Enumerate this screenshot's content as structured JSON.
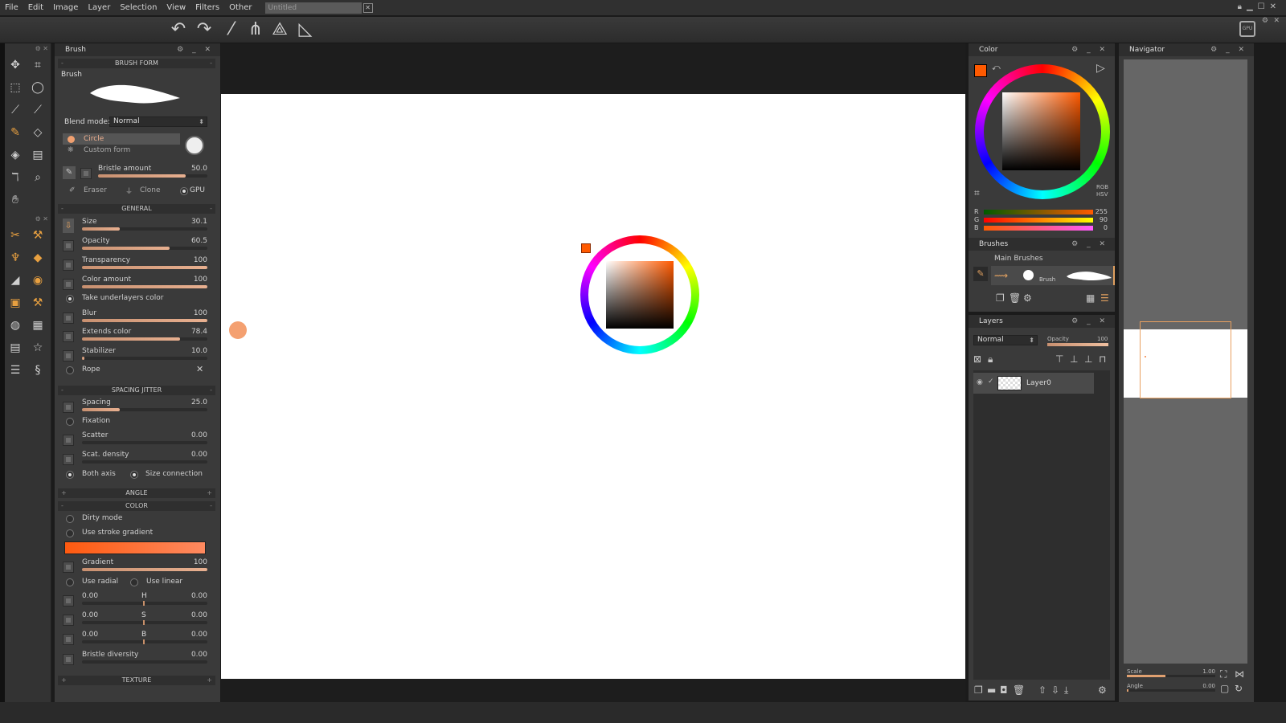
{
  "menu": {
    "items": [
      "File",
      "Edit",
      "Image",
      "Layer",
      "Selection",
      "View",
      "Filters",
      "Other"
    ],
    "doc_tab": "Untitled"
  },
  "brush_panel": {
    "title": "Brush",
    "brush_form_header": "BRUSH FORM",
    "brush_label": "Brush",
    "blend_mode_label": "Blend mode:",
    "blend_mode_value": "Normal",
    "shape_circle": "Circle",
    "shape_custom": "Custom form",
    "bristle": {
      "label": "Bristle amount",
      "value": "50.0",
      "fraction": 0.8
    },
    "eraser": "Eraser",
    "clone": "Clone",
    "gpu": "GPU",
    "general_header": "GENERAL",
    "general_sliders": [
      {
        "label": "Size",
        "value": "30.1",
        "fraction": 0.3
      },
      {
        "label": "Opacity",
        "value": "60.5",
        "fraction": 0.7
      },
      {
        "label": "Transparency",
        "value": "100",
        "fraction": 1.0
      },
      {
        "label": "Color amount",
        "value": "100",
        "fraction": 1.0
      }
    ],
    "take_underlayers": "Take underlayers color",
    "general_sliders2": [
      {
        "label": "Blur",
        "value": "100",
        "fraction": 1.0
      },
      {
        "label": "Extends color",
        "value": "78.4",
        "fraction": 0.78
      },
      {
        "label": "Stabilizer",
        "value": "10.0",
        "fraction": 0.02
      }
    ],
    "rope": "Rope",
    "spacing_header": "SPACING JITTER",
    "spacing": {
      "label": "Spacing",
      "value": "25.0",
      "fraction": 0.3
    },
    "fixation": "Fixation",
    "scatter": {
      "label": "Scatter",
      "value": "0.00",
      "fraction": 0.0
    },
    "scat_density": {
      "label": "Scat. density",
      "value": "0.00",
      "fraction": 0.0
    },
    "both_axis": "Both axis",
    "size_connection": "Size connection",
    "angle_header": "ANGLE",
    "color_header": "COLOR",
    "dirty_mode": "Dirty mode",
    "use_stroke_gradient": "Use stroke gradient",
    "gradient": {
      "label": "Gradient",
      "value": "100",
      "fraction": 1.0
    },
    "use_radial": "Use radial",
    "use_linear": "Use linear",
    "hsb": [
      {
        "left": "0.00",
        "mid": "H",
        "right": "0.00"
      },
      {
        "left": "0.00",
        "mid": "S",
        "right": "0.00"
      },
      {
        "left": "0.00",
        "mid": "B",
        "right": "0.00"
      }
    ],
    "bristle_diversity": {
      "label": "Bristle diversity",
      "value": "0.00",
      "fraction": 0.0
    },
    "texture_header": "TEXTURE"
  },
  "color_panel": {
    "title": "Color",
    "rgb_label": "RGB",
    "hsv_label": "HSV",
    "r": {
      "label": "R",
      "value": "255"
    },
    "g": {
      "label": "G",
      "value": "90"
    },
    "b": {
      "label": "B",
      "value": "0"
    },
    "current_color": "#ff5a00"
  },
  "brushes_panel": {
    "title": "Brushes",
    "group": "Main Brushes",
    "brush_name": "Brush"
  },
  "layers_panel": {
    "title": "Layers",
    "blend": "Normal",
    "opacity_label": "Opacity",
    "opacity_value": "100",
    "layer_name": "Layer0"
  },
  "navigator": {
    "title": "Navigator",
    "scale_label": "Scale",
    "scale_value": "1.00",
    "angle_label": "Angle",
    "angle_value": "0.00"
  },
  "gpu_chip": "GPU"
}
